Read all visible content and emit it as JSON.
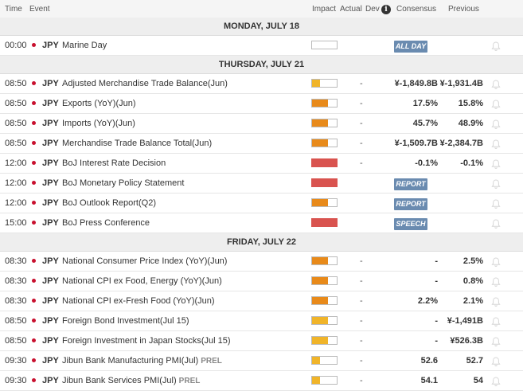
{
  "header": {
    "time": "Time",
    "event": "Event",
    "impact": "Impact",
    "actual": "Actual",
    "dev": "Dev",
    "info_icon": "i",
    "consensus": "Consensus",
    "previous": "Previous"
  },
  "rows": [
    {
      "type": "day",
      "label": "MONDAY, JULY 18"
    },
    {
      "type": "event",
      "time": "00:00",
      "currency": "JPY",
      "event": "Marine Day",
      "tag": "",
      "impact": "none",
      "impact_level": 0,
      "actual": "",
      "consensus": "",
      "previous": "",
      "badge": "ALL DAY"
    },
    {
      "type": "day",
      "label": "THURSDAY, JULY 21"
    },
    {
      "type": "event",
      "time": "08:50",
      "currency": "JPY",
      "event": "Adjusted Merchandise Trade Balance(Jun)",
      "tag": "",
      "impact": "low",
      "impact_level": 0.33,
      "actual": "-",
      "consensus": "¥-1,849.8B",
      "previous": "¥-1,931.4B",
      "badge": ""
    },
    {
      "type": "event",
      "time": "08:50",
      "currency": "JPY",
      "event": "Exports (YoY)(Jun)",
      "tag": "",
      "impact": "medium",
      "impact_level": 0.66,
      "actual": "-",
      "consensus": "17.5%",
      "previous": "15.8%",
      "badge": ""
    },
    {
      "type": "event",
      "time": "08:50",
      "currency": "JPY",
      "event": "Imports (YoY)(Jun)",
      "tag": "",
      "impact": "medium",
      "impact_level": 0.66,
      "actual": "-",
      "consensus": "45.7%",
      "previous": "48.9%",
      "badge": ""
    },
    {
      "type": "event",
      "time": "08:50",
      "currency": "JPY",
      "event": "Merchandise Trade Balance Total(Jun)",
      "tag": "",
      "impact": "medium",
      "impact_level": 0.66,
      "actual": "-",
      "consensus": "¥-1,509.7B",
      "previous": "¥-2,384.7B",
      "badge": ""
    },
    {
      "type": "event",
      "time": "12:00",
      "currency": "JPY",
      "event": "BoJ Interest Rate Decision",
      "tag": "",
      "impact": "high",
      "impact_level": 1,
      "actual": "-",
      "consensus": "-0.1%",
      "previous": "-0.1%",
      "badge": ""
    },
    {
      "type": "event",
      "time": "12:00",
      "currency": "JPY",
      "event": "BoJ Monetary Policy Statement",
      "tag": "",
      "impact": "high",
      "impact_level": 1,
      "actual": "",
      "consensus": "",
      "previous": "",
      "badge": "REPORT"
    },
    {
      "type": "event",
      "time": "12:00",
      "currency": "JPY",
      "event": "BoJ Outlook Report(Q2)",
      "tag": "",
      "impact": "medium",
      "impact_level": 0.66,
      "actual": "",
      "consensus": "",
      "previous": "",
      "badge": "REPORT"
    },
    {
      "type": "event",
      "time": "15:00",
      "currency": "JPY",
      "event": "BoJ Press Conference",
      "tag": "",
      "impact": "high",
      "impact_level": 1,
      "actual": "",
      "consensus": "",
      "previous": "",
      "badge": "SPEECH"
    },
    {
      "type": "day",
      "label": "FRIDAY, JULY 22"
    },
    {
      "type": "event",
      "time": "08:30",
      "currency": "JPY",
      "event": "National Consumer Price Index (YoY)(Jun)",
      "tag": "",
      "impact": "medium",
      "impact_level": 0.66,
      "actual": "-",
      "consensus": "-",
      "previous": "2.5%",
      "badge": ""
    },
    {
      "type": "event",
      "time": "08:30",
      "currency": "JPY",
      "event": "National CPI ex Food, Energy (YoY)(Jun)",
      "tag": "",
      "impact": "medium",
      "impact_level": 0.66,
      "actual": "-",
      "consensus": "-",
      "previous": "0.8%",
      "badge": ""
    },
    {
      "type": "event",
      "time": "08:30",
      "currency": "JPY",
      "event": "National CPI ex-Fresh Food (YoY)(Jun)",
      "tag": "",
      "impact": "medium",
      "impact_level": 0.66,
      "actual": "-",
      "consensus": "2.2%",
      "previous": "2.1%",
      "badge": ""
    },
    {
      "type": "event",
      "time": "08:50",
      "currency": "JPY",
      "event": "Foreign Bond Investment(Jul 15)",
      "tag": "",
      "impact": "low",
      "impact_level": 0.66,
      "actual": "-",
      "consensus": "-",
      "previous": "¥-1,491B",
      "badge": ""
    },
    {
      "type": "event",
      "time": "08:50",
      "currency": "JPY",
      "event": "Foreign Investment in Japan Stocks(Jul 15)",
      "tag": "",
      "impact": "low",
      "impact_level": 0.66,
      "actual": "-",
      "consensus": "-",
      "previous": "¥526.3B",
      "badge": ""
    },
    {
      "type": "event",
      "time": "09:30",
      "currency": "JPY",
      "event": "Jibun Bank Manufacturing PMI(Jul)",
      "tag": "PREL",
      "impact": "low",
      "impact_level": 0.33,
      "actual": "-",
      "consensus": "52.6",
      "previous": "52.7",
      "badge": ""
    },
    {
      "type": "event",
      "time": "09:30",
      "currency": "JPY",
      "event": "Jibun Bank Services PMI(Jul)",
      "tag": "PREL",
      "impact": "low",
      "impact_level": 0.33,
      "actual": "-",
      "consensus": "54.1",
      "previous": "54",
      "badge": ""
    }
  ],
  "colors": {
    "low": "#f0b429",
    "medium": "#e88a1a",
    "high": "#d9534f",
    "badge": "#6a8bb0",
    "flag": "#c8102e"
  },
  "icons": {
    "flag": "japan-flag-icon",
    "reminder": "bell-icon",
    "info": "info-icon"
  }
}
